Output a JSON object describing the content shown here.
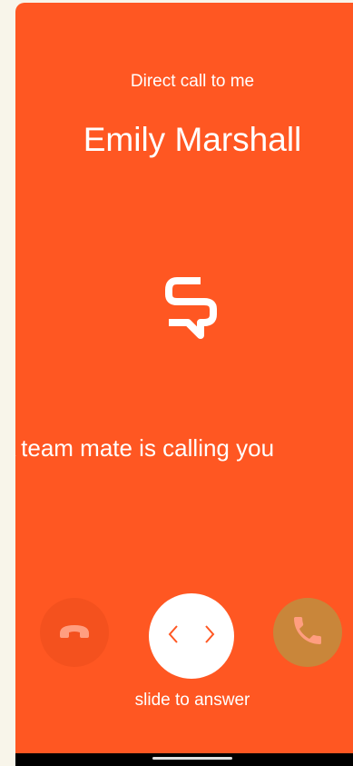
{
  "call": {
    "type_label": "Direct call to me",
    "caller_name": "Emily Marshall",
    "message": "A team mate is calling you"
  },
  "controls": {
    "slide_hint": "slide to answer",
    "decline_icon": "phone-hangup-icon",
    "answer_icon": "phone-answer-icon",
    "knob_icons": [
      "chevron-left-icon",
      "chevron-right-icon"
    ]
  },
  "colors": {
    "background": "#ff5722",
    "decline": "#f4511e",
    "answer": "#c9863a",
    "knob": "#ffffff"
  }
}
